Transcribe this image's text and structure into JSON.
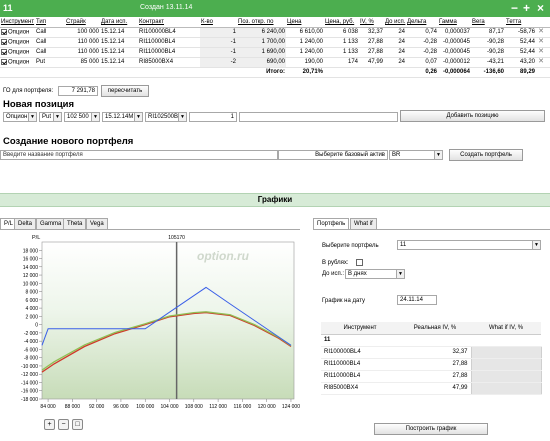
{
  "window": {
    "title_num": "11",
    "created": "Создан 13.11.14"
  },
  "table": {
    "headers": [
      "Инструмент",
      "Тип",
      "Страйк",
      "Дата исп.",
      "Контракт",
      "К-во",
      "Поз. откр. по",
      "Цена",
      "Цена, руб.",
      "IV, %",
      "До исп.",
      "Дельта",
      "Гамма",
      "Вега",
      "Тетта"
    ],
    "rows": [
      [
        "Опцион",
        "Call",
        "100 000",
        "15.12.14",
        "RI100000BL4",
        "1",
        "6 240,00",
        "6 610,00",
        "6 038",
        "32,37",
        "24",
        "0,74",
        "0,000037",
        "87,17",
        "-58,76"
      ],
      [
        "Опцион",
        "Call",
        "110 000",
        "15.12.14",
        "RI110000BL4",
        "-1",
        "1 700,00",
        "1 240,00",
        "1 133",
        "27,88",
        "24",
        "-0,28",
        "-0,000045",
        "-90,28",
        "52,44"
      ],
      [
        "Опцион",
        "Call",
        "110 000",
        "15.12.14",
        "RI110000BL4",
        "-1",
        "1 690,00",
        "1 240,00",
        "1 133",
        "27,88",
        "24",
        "-0,28",
        "-0,000045",
        "-90,28",
        "52,44"
      ],
      [
        "Опцион",
        "Put",
        "85 000",
        "15.12.14",
        "RI85000BX4",
        "-2",
        "690,00",
        "190,00",
        "174",
        "47,99",
        "24",
        "0,07",
        "-0,000012",
        "-43,21",
        "43,20"
      ]
    ],
    "total_label": "Итого:",
    "total_pct": "20,71%",
    "total_delta": "0,26",
    "total_gamma": "-0,000064",
    "total_vega": "-136,60",
    "total_theta": "89,29"
  },
  "go": {
    "label": "ГО для портфеля:",
    "value": "7 291,78",
    "button": "пересчитать"
  },
  "new_position": {
    "title": "Новая позиция",
    "instrument": "Опцион",
    "type": "Put",
    "strike": "102 500",
    "date": "15.12.14М",
    "contract": "RI102500BX4",
    "qty": "1",
    "button": "Добавить позицию"
  },
  "new_portfolio": {
    "title": "Создание нового портфеля",
    "name_placeholder": "Введите название портфеля",
    "asset_label": "Выберите базовый актив",
    "asset": "BR",
    "button": "Создать портфель"
  },
  "charts": {
    "title": "Графики",
    "tabs": [
      "P/L",
      "Delta",
      "Gamma",
      "Theta",
      "Vega"
    ],
    "ylabel": "P/L",
    "marker": "105170",
    "watermark": "option.ru",
    "zoom_in": "+",
    "zoom_out": "−",
    "zoom_fit": "□"
  },
  "right": {
    "tabs": [
      "Портфель",
      "What if"
    ],
    "portfolio_label": "Выберите портфель",
    "portfolio": "11",
    "rub_label": "В рублях:",
    "to_exp_label": "До исп.:",
    "to_exp": "В днях",
    "date_label": "График на дату",
    "date": "24.11.14",
    "table_headers": [
      "Инструмент",
      "Реальная IV, %",
      "What if IV, %"
    ],
    "group": "11",
    "rows": [
      [
        "RI100000BL4",
        "32,37"
      ],
      [
        "RI110000BL4",
        "27,88"
      ],
      [
        "RI110000BL4",
        "27,88"
      ],
      [
        "RI85000BX4",
        "47,99"
      ]
    ],
    "build_button": "Построить график"
  },
  "chart_data": {
    "type": "line",
    "title": "",
    "xlabel": "",
    "ylabel": "P/L",
    "x": [
      83000,
      84000,
      85000,
      90000,
      95000,
      100000,
      104000,
      108000,
      110000,
      114000,
      118000,
      122000,
      124000
    ],
    "xlim": [
      83000,
      124500
    ],
    "ylim": [
      -18000,
      20000
    ],
    "xticks": [
      "84 000",
      "88 000",
      "92 000",
      "96 000",
      "100 000",
      "104 000",
      "108 000",
      "112 000",
      "116 000",
      "120 000",
      "124 000"
    ],
    "xtick_values": [
      84000,
      88000,
      92000,
      96000,
      100000,
      104000,
      108000,
      112000,
      116000,
      120000,
      124000
    ],
    "yticks": [
      "18 000",
      "16 000",
      "14 000",
      "12 000",
      "10 000",
      "8 000",
      "6 000",
      "4 000",
      "2 000",
      "0",
      "-2 000",
      "-4 000",
      "-6 000",
      "-8 000",
      "-10 000",
      "-12 000",
      "-14 000",
      "-16 000",
      "-18 000"
    ],
    "ytick_values": [
      18000,
      16000,
      14000,
      12000,
      10000,
      8000,
      6000,
      4000,
      2000,
      0,
      -2000,
      -4000,
      -6000,
      -8000,
      -10000,
      -12000,
      -14000,
      -16000,
      -18000
    ],
    "vline": 105170,
    "series": [
      {
        "color": "#3a5fe8",
        "values": [
          -5000,
          -1000,
          -1000,
          -1000,
          -1000,
          -1000,
          3000,
          7000,
          9000,
          5000,
          1000,
          -3000,
          -5000
        ]
      },
      {
        "color": "#d0392a",
        "values": [
          -11500,
          -10500,
          -9500,
          -5300,
          -2200,
          0,
          1900,
          2700,
          2900,
          2200,
          -200,
          -3300,
          -5300
        ]
      },
      {
        "color": "#8fbf54",
        "values": [
          -11000,
          -10000,
          -9000,
          -4900,
          -1900,
          200,
          2100,
          2900,
          3100,
          2400,
          0,
          -3100,
          -5100
        ]
      }
    ]
  }
}
